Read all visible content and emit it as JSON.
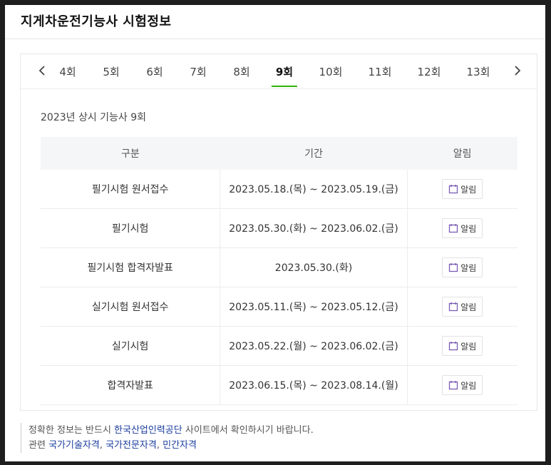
{
  "page_title": "지게차운전기능사 시험정보",
  "rounds": {
    "prev_icon": "chevron-left-icon",
    "next_icon": "chevron-right-icon",
    "tabs": [
      "4회",
      "5회",
      "6회",
      "7회",
      "8회",
      "9회",
      "10회",
      "11회",
      "12회",
      "13회"
    ],
    "active": "9회"
  },
  "exam_heading": "2023년 상시 기능사 9회",
  "table": {
    "headers": [
      "구분",
      "기간",
      "알림"
    ],
    "rows": [
      {
        "category": "필기시험 원서접수",
        "period": "2023.05.18.(목) ~ 2023.05.19.(금)",
        "alarm": "알림"
      },
      {
        "category": "필기시험",
        "period": "2023.05.30.(화) ~ 2023.06.02.(금)",
        "alarm": "알림"
      },
      {
        "category": "필기시험 합격자발표",
        "period": "2023.05.30.(화)",
        "alarm": "알림"
      },
      {
        "category": "실기시험 원서접수",
        "period": "2023.05.11.(목) ~ 2023.05.12.(금)",
        "alarm": "알림"
      },
      {
        "category": "실기시험",
        "period": "2023.05.22.(월) ~ 2023.06.02.(금)",
        "alarm": "알림"
      },
      {
        "category": "합격자발표",
        "period": "2023.06.15.(목) ~ 2023.08.14.(월)",
        "alarm": "알림"
      }
    ],
    "alarm_icon": "calendar-icon"
  },
  "footer": {
    "line1_prefix": "정확한 정보는 반드시 ",
    "line1_link": "한국산업인력공단",
    "line1_suffix": " 사이트에서 확인하시기 바랍니다.",
    "line2_prefix": "관련 ",
    "line2_links": [
      "국가기술자격",
      "국가전문자격",
      "민간자격"
    ],
    "line2_separator": ", "
  },
  "colors": {
    "active_tab_underline": "#2db400",
    "link": "#1a3c9e",
    "alarm_icon": "#7b5bb5"
  }
}
